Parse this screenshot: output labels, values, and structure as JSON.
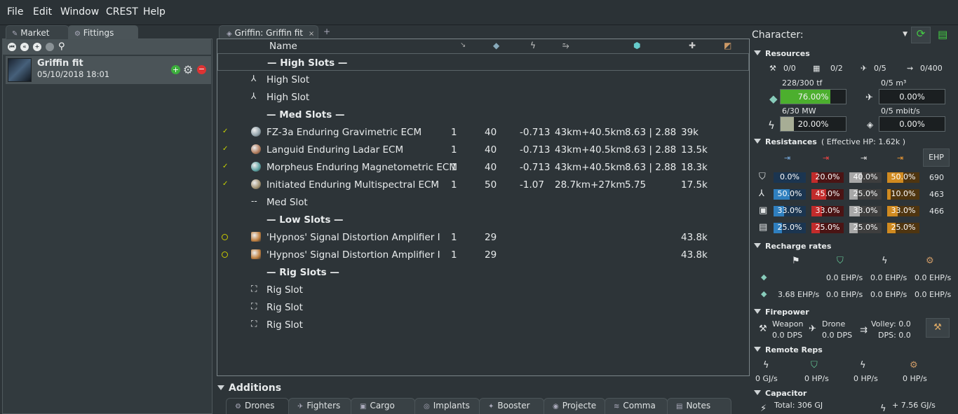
{
  "menu": [
    "File",
    "Edit",
    "Window",
    "CREST",
    "Help"
  ],
  "left": {
    "tabs": [
      "Market",
      "Fittings"
    ],
    "fit": {
      "name": "Griffin fit",
      "date": "05/10/2018 18:01"
    }
  },
  "center": {
    "tab_title": "Griffin: Griffin fit",
    "header_name": "Name",
    "rows": [
      {
        "kind": "section",
        "name": "— High Slots —"
      },
      {
        "kind": "slot",
        "icon": "high-slot-icon",
        "name": "High Slot"
      },
      {
        "kind": "slot",
        "icon": "high-slot-icon",
        "name": "High Slot"
      },
      {
        "kind": "section",
        "name": "— Med Slots —"
      },
      {
        "kind": "module",
        "state": "check",
        "name": "FZ-3a Enduring Gravimetric ECM",
        "c1": "1",
        "c2": "40",
        "c3": "-0.713",
        "c4": "43km+40.5km",
        "c5": "8.63 | 2.88",
        "c6": "39k",
        "tint": "#8fa0a8"
      },
      {
        "kind": "module",
        "state": "check",
        "name": "Languid Enduring Ladar ECM",
        "c1": "1",
        "c2": "40",
        "c3": "-0.713",
        "c4": "43km+40.5km",
        "c5": "8.63 | 2.88",
        "c6": "13.5k",
        "tint": "#b07a5a"
      },
      {
        "kind": "module",
        "state": "check",
        "name": "Morpheus Enduring Magnetometric ECM",
        "c1": "1",
        "c2": "40",
        "c3": "-0.713",
        "c4": "43km+40.5km",
        "c5": "8.63 | 2.88",
        "c6": "18.3k",
        "tint": "#5aa0a0"
      },
      {
        "kind": "module",
        "state": "check",
        "name": "Initiated Enduring Multispectral ECM",
        "c1": "1",
        "c2": "50",
        "c3": "-1.07",
        "c4": "28.7km+27km",
        "c5": "5.75",
        "c6": "17.5k",
        "tint": "#a09070"
      },
      {
        "kind": "slot",
        "icon": "med-slot-icon",
        "name": "Med Slot"
      },
      {
        "kind": "section",
        "name": "— Low Slots —"
      },
      {
        "kind": "module",
        "state": "ring",
        "name": "'Hypnos' Signal Distortion Amplifier I",
        "c1": "1",
        "c2": "29",
        "c3": "",
        "c4": "",
        "c5": "",
        "c6": "43.8k",
        "tint": "#c08040"
      },
      {
        "kind": "module",
        "state": "ring",
        "name": "'Hypnos' Signal Distortion Amplifier I",
        "c1": "1",
        "c2": "29",
        "c3": "",
        "c4": "",
        "c5": "",
        "c6": "43.8k",
        "tint": "#c08040"
      },
      {
        "kind": "section",
        "name": "— Rig Slots —"
      },
      {
        "kind": "slot",
        "icon": "rig-slot-icon",
        "name": "Rig Slot"
      },
      {
        "kind": "slot",
        "icon": "rig-slot-icon",
        "name": "Rig Slot"
      },
      {
        "kind": "slot",
        "icon": "rig-slot-icon",
        "name": "Rig Slot"
      }
    ],
    "additions_label": "Additions",
    "bottom_tabs": [
      "Drones",
      "Fighters",
      "Cargo",
      "Implants",
      "Booster",
      "Projecte",
      "Comma",
      "Notes"
    ]
  },
  "right": {
    "character_label": "Character:",
    "resources_label": "Resources",
    "hardpoints": [
      "0/0",
      "0/2",
      "0/5",
      "0/400"
    ],
    "cpu_label": "228/300 tf",
    "cpu_pct": "76.00%",
    "cpu_fraction": 0.76,
    "drone_bay_label": "0/5 m³",
    "drone_bay_pct": "0.00%",
    "pg_label": "6/30 MW",
    "pg_pct": "20.00%",
    "pg_fraction": 0.2,
    "bandwidth_label": "0/5 mbit/s",
    "bandwidth_pct": "0.00%",
    "resistances_label": "Resistances",
    "effective_hp": "( Effective HP: 1.62k )",
    "ehp_label": "EHP",
    "resist_rows": [
      {
        "values": [
          "0.0%",
          "20.0%",
          "40.0%",
          "50.0%"
        ],
        "fractions": [
          0.0,
          0.2,
          0.4,
          0.5
        ],
        "ehp": "690"
      },
      {
        "values": [
          "50.0%",
          "45.0%",
          "25.0%",
          "10.0%"
        ],
        "fractions": [
          0.5,
          0.45,
          0.25,
          0.1
        ],
        "ehp": "463"
      },
      {
        "values": [
          "33.0%",
          "33.0%",
          "33.0%",
          "33.0%"
        ],
        "fractions": [
          0.33,
          0.33,
          0.33,
          0.33
        ],
        "ehp": "466"
      },
      {
        "values": [
          "25.0%",
          "25.0%",
          "25.0%",
          "25.0%"
        ],
        "fractions": [
          0.25,
          0.25,
          0.25,
          0.25
        ],
        "ehp": ""
      }
    ],
    "resist_colors": [
      "#2f7fbf",
      "#c22b2b",
      "#a8a8a8",
      "#d08a20"
    ],
    "recharge_label": "Recharge rates",
    "recharge_rows": [
      [
        "",
        "0.0 EHP/s",
        "0.0 EHP/s",
        "0.0 EHP/s"
      ],
      [
        "3.68 EHP/s",
        "0.0 EHP/s",
        "0.0 EHP/s",
        "0.0 EHP/s"
      ]
    ],
    "firepower_label": "Firepower",
    "weapon_label": "Weapon",
    "weapon_dps": "0.0 DPS",
    "drone_label": "Drone",
    "drone_dps": "0.0 DPS",
    "volley": "Volley: 0.0",
    "dps": "DPS: 0.0",
    "remote_label": "Remote Reps",
    "remote_values": [
      "0 GJ/s",
      "0 HP/s",
      "0 HP/s",
      "0 HP/s"
    ],
    "capacitor_label": "Capacitor",
    "cap_total": "Total: 306 GJ",
    "cap_rate": "+ 7.56 GJ/s"
  }
}
